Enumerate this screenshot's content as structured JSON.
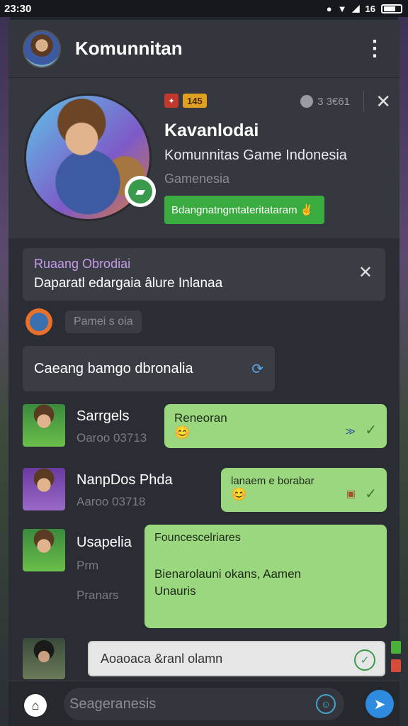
{
  "statusbar": {
    "time": "23:30",
    "battery": "16"
  },
  "header": {
    "title": "Komunnitan"
  },
  "profile": {
    "level_badge": "145",
    "meta_count": "3 3€61",
    "name": "Kavanlodai",
    "subtitle": "Komunnitas Game Indonesia",
    "category": "Gamenesia",
    "join_label": "Bdangnatngmtateritataram"
  },
  "notice": {
    "title": "Ruaang Obrodiai",
    "body": "Daparatl edargaia âlure Inlanaa"
  },
  "typing": {
    "chip": "Pamei s oia"
  },
  "room": {
    "label": "Caeang bamgo dbronalia"
  },
  "messages": [
    {
      "name": "Sarrgels",
      "id": "Oaroo 03713",
      "bubble": "Reneoran"
    },
    {
      "name": "NanpDos Phda",
      "id": "Aaroo 03718",
      "bubble": "lanaem e borabar"
    },
    {
      "name": "Usapelia",
      "id": "Prm",
      "id2": "Pranars",
      "bubble_title": "Founcescelriares",
      "bubble_body": "Bienarolauni okans, Aamen Unauris"
    }
  ],
  "composer": {
    "placeholder": "Aoaoaca &ranl olamn"
  },
  "bottom_nav": {
    "search_placeholder": "Seageranesis"
  },
  "colors": {
    "accent_green": "#3aab3e",
    "bubble_green": "#9bd77f",
    "send_blue": "#2e8be0"
  }
}
